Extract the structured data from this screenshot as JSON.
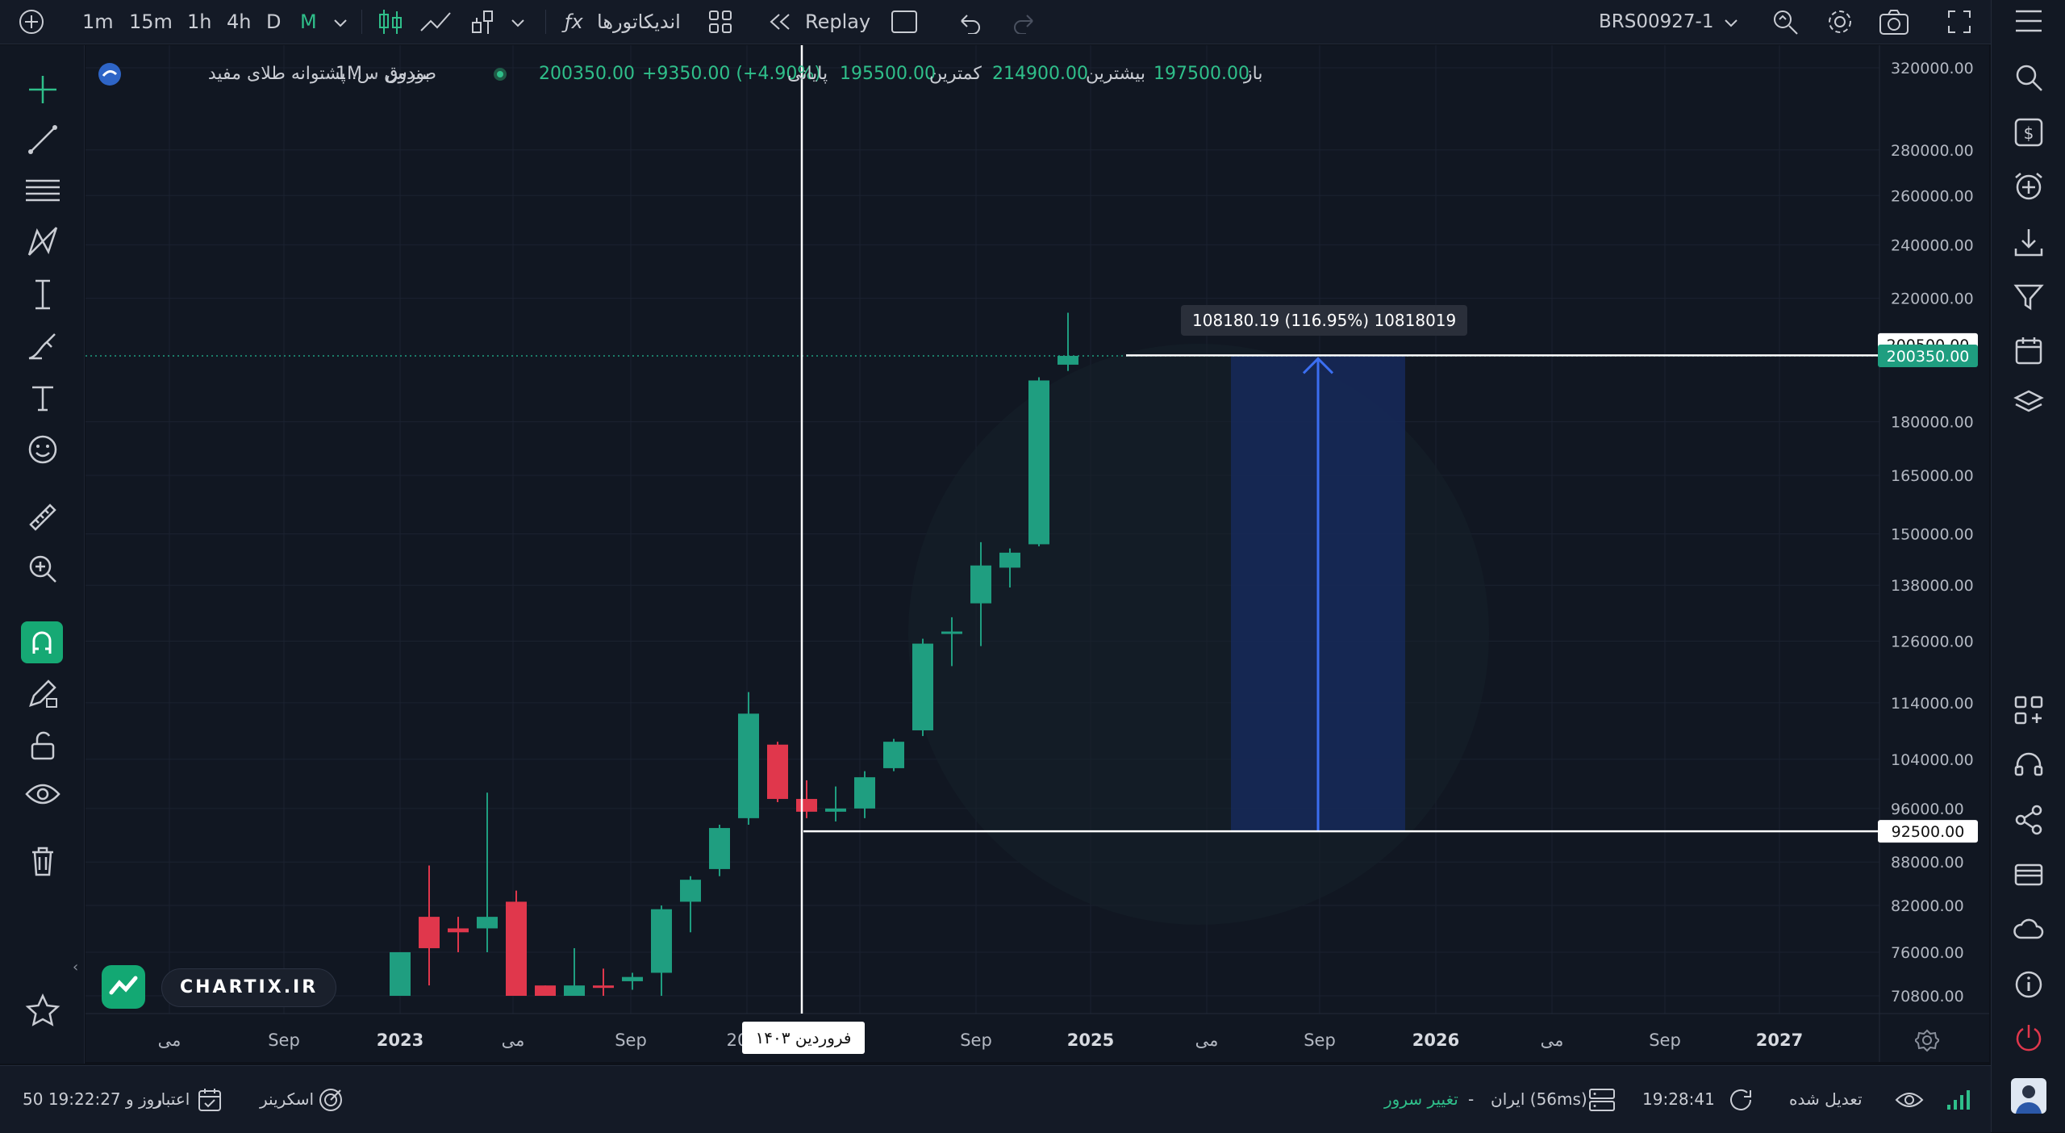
{
  "topbar": {
    "intervals": [
      "1m",
      "15m",
      "1h",
      "4h",
      "D",
      "M"
    ],
    "active_interval": "M",
    "indicators_label": "اندیکاتورها",
    "replay_label": "Replay",
    "symbol": "BRS00927-1"
  },
  "legend": {
    "title": "صندوق س. پشتوانه طلای مفید",
    "interval": "1M",
    "exchange": "بورس",
    "open_label": "باز",
    "open_value": "197500.00",
    "high_label": "بیشترین",
    "high_value": "214900.00",
    "low_label": "کمترین",
    "low_value": "195500.00",
    "close_label": "پایانی",
    "close_value": "200350.00",
    "change_value": "+9350.00 (+4.90%)"
  },
  "measure": {
    "label": "108180.19 (116.95%) 10818019"
  },
  "price_axis": {
    "ticks": [
      "320000.00",
      "280000.00",
      "260000.00",
      "240000.00",
      "220000.00",
      "180000.00",
      "165000.00",
      "150000.00",
      "138000.00",
      "126000.00",
      "114000.00",
      "104000.00",
      "96000.00",
      "88000.00",
      "82000.00",
      "76000.00",
      "70800.00"
    ],
    "label_high": "200500.00",
    "label_last": "200350.00",
    "label_low": "92500.00"
  },
  "time_axis": {
    "labels": [
      "می",
      "Sep",
      "2023",
      "می",
      "Sep",
      "20",
      "م",
      "Sep",
      "2025",
      "می",
      "Sep",
      "2026",
      "می",
      "Sep",
      "2027"
    ],
    "crosshair_label": "فروردین ۱۴۰۳"
  },
  "watermark": "CHARTIX.IR",
  "bottombar": {
    "credit_label": "اعتبار",
    "credit_value": "50 روز و 19:22:27",
    "screener_label": "اسکرینر",
    "server_label": "تغییر سرور",
    "server_dash": "-",
    "server_value": "ایران (56ms)",
    "clock": "19:28:41",
    "adjusted_label": "تعدیل شده"
  },
  "colors": {
    "up": "#1f9e80",
    "down": "#e0374c",
    "accent": "#2fbf8a",
    "measure_fill": "#16295a",
    "measure_line": "#3b6ef0"
  },
  "icons": {
    "left_tools": [
      "crosshair-icon",
      "trend-line-icon",
      "fib-lines-icon",
      "pattern-icon",
      "projection-icon",
      "brush-icon",
      "text-icon",
      "emoji-icon",
      "ruler-icon",
      "zoom-in-icon",
      "magnet-icon",
      "edit-lock-icon",
      "unlock-icon",
      "eye-icon",
      "trash-icon",
      "star-icon"
    ],
    "right_bar": [
      "menu-icon",
      "search-icon",
      "dollar-icon",
      "add-alert-icon",
      "download-icon",
      "filter-icon",
      "calendar-icon",
      "layers-icon",
      "widgets-icon",
      "support-icon",
      "share-icon",
      "card-icon",
      "cloud-icon",
      "info-icon",
      "power-icon"
    ]
  },
  "chart_data": {
    "type": "candlestick",
    "interval": "1M",
    "candles": [
      {
        "o": 76000,
        "h": 76000,
        "l": 70800,
        "c": 70800,
        "dir": "up"
      },
      {
        "o": 80500,
        "h": 87500,
        "l": 72000,
        "c": 76500,
        "dir": "down"
      },
      {
        "o": 79000,
        "h": 80500,
        "l": 76000,
        "c": 78500,
        "dir": "down"
      },
      {
        "o": 79000,
        "h": 98500,
        "l": 76000,
        "c": 80500,
        "dir": "up"
      },
      {
        "o": 82500,
        "h": 84000,
        "l": 70800,
        "c": 70800,
        "dir": "down"
      },
      {
        "o": 72000,
        "h": 72000,
        "l": 70800,
        "c": 70800,
        "dir": "down"
      },
      {
        "o": 72000,
        "h": 76500,
        "l": 70800,
        "c": 70800,
        "dir": "up"
      },
      {
        "o": 72000,
        "h": 74000,
        "l": 70800,
        "c": 72000,
        "dir": "down"
      },
      {
        "o": 72500,
        "h": 73500,
        "l": 71500,
        "c": 73000,
        "dir": "up"
      },
      {
        "o": 73500,
        "h": 82000,
        "l": 70800,
        "c": 81500,
        "dir": "up"
      },
      {
        "o": 82500,
        "h": 86000,
        "l": 78500,
        "c": 85500,
        "dir": "up"
      },
      {
        "o": 87000,
        "h": 93500,
        "l": 86000,
        "c": 93000,
        "dir": "up"
      },
      {
        "o": 94500,
        "h": 116000,
        "l": 93500,
        "c": 112000,
        "dir": "up"
      },
      {
        "o": 106500,
        "h": 107000,
        "l": 97000,
        "c": 97500,
        "dir": "down"
      },
      {
        "o": 97500,
        "h": 100500,
        "l": 94500,
        "c": 95500,
        "dir": "down"
      },
      {
        "o": 95500,
        "h": 99500,
        "l": 94000,
        "c": 96000,
        "dir": "up"
      },
      {
        "o": 96000,
        "h": 102000,
        "l": 94500,
        "c": 101000,
        "dir": "up"
      },
      {
        "o": 102500,
        "h": 107500,
        "l": 102000,
        "c": 107000,
        "dir": "up"
      },
      {
        "o": 109000,
        "h": 126500,
        "l": 108000,
        "c": 125500,
        "dir": "up"
      },
      {
        "o": 128000,
        "h": 131000,
        "l": 121000,
        "c": 128000,
        "dir": "up"
      },
      {
        "o": 134000,
        "h": 148000,
        "l": 125000,
        "c": 142500,
        "dir": "up"
      },
      {
        "o": 142000,
        "h": 146500,
        "l": 137500,
        "c": 145500,
        "dir": "up"
      },
      {
        "o": 147500,
        "h": 193500,
        "l": 147000,
        "c": 192500,
        "dir": "up"
      },
      {
        "o": 197500,
        "h": 214900,
        "l": 195500,
        "c": 200350,
        "dir": "up"
      }
    ],
    "measure_from": 92500,
    "measure_to": 200500,
    "y_axis": "log",
    "y_range": [
      66000,
      330000
    ]
  }
}
